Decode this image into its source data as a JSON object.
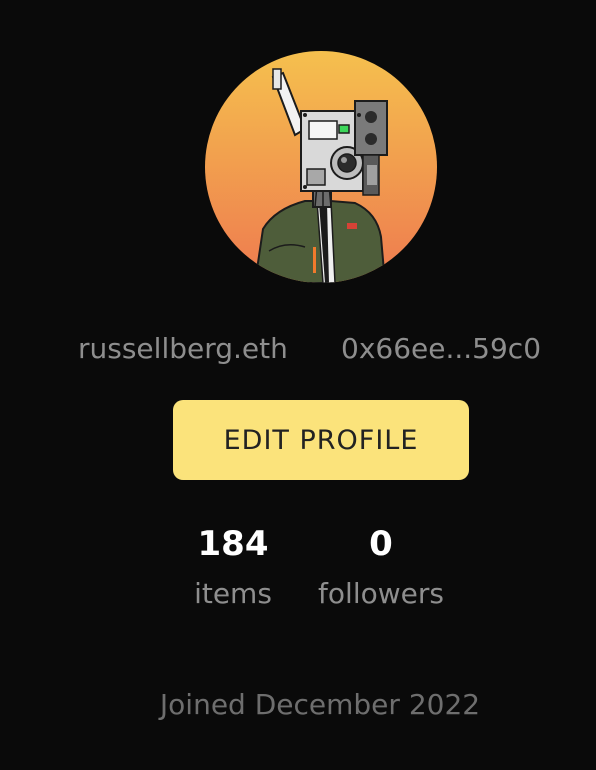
{
  "profile": {
    "ens_name": "russellberg.eth",
    "wallet_address": "0x66ee...59c0",
    "edit_label": "EDIT PROFILE",
    "joined": "Joined December 2022",
    "avatar_icon": "robot-avatar-icon"
  },
  "stats": {
    "items": {
      "value": "184",
      "label": "items"
    },
    "followers": {
      "value": "0",
      "label": "followers"
    }
  },
  "colors": {
    "background": "#0a0a0a",
    "button": "#fbe37b",
    "muted_text": "#8e8e8e",
    "avatar_gradient_top": "#f5c04e",
    "avatar_gradient_bottom": "#ee7a4f"
  }
}
